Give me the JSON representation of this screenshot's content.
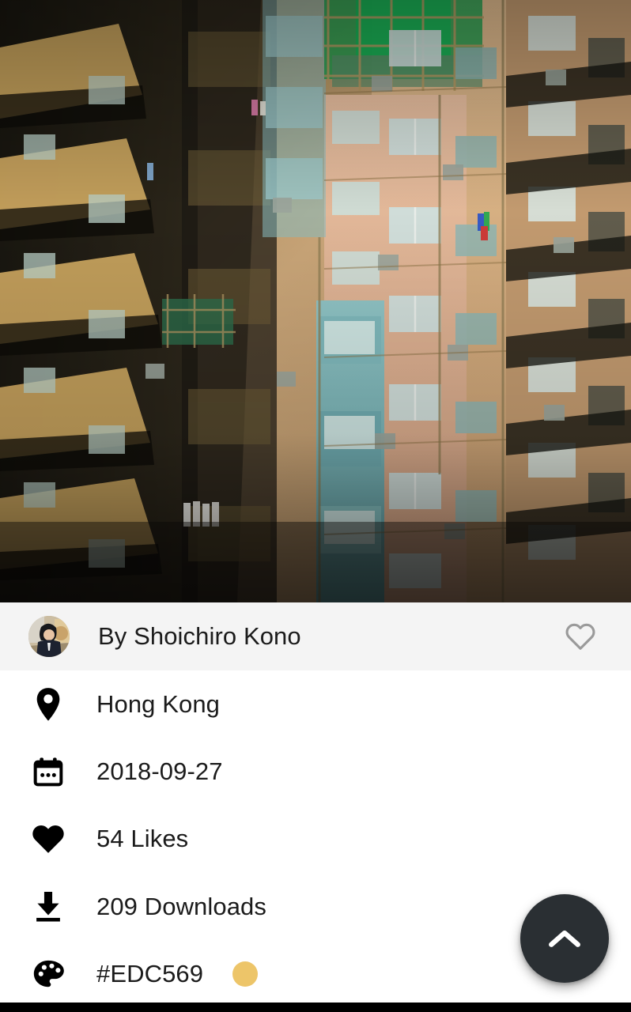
{
  "photo": {
    "alt_description": "Dense weathered Hong Kong apartment block facade with stacked balconies, air conditioners and green bamboo scaffolding netting",
    "dominant_color": "#EDC569"
  },
  "author_bar": {
    "avatar_name": "avatar",
    "byline": "By Shoichiro Kono",
    "like_icon": "heart-outline-icon",
    "like_state": "not-liked"
  },
  "info": {
    "rows": [
      {
        "icon": "location-pin-icon",
        "label": "Hong Kong"
      },
      {
        "icon": "calendar-icon",
        "label": "2018-09-27"
      },
      {
        "icon": "heart-filled-icon",
        "label": "54 Likes"
      },
      {
        "icon": "download-icon",
        "label": "209 Downloads"
      },
      {
        "icon": "palette-icon",
        "label": "#EDC569",
        "swatch": "#EDC569"
      }
    ]
  },
  "fab": {
    "icon": "chevron-up-icon",
    "label": "Scroll to top",
    "background": "#2A2F33"
  },
  "colors": {
    "author_bar_bg": "#F4F4F4",
    "list_bg": "#FFFFFF",
    "text": "#1B1B1B",
    "heart_outline": "#9A9A9A",
    "nav_bar": "#000000"
  }
}
